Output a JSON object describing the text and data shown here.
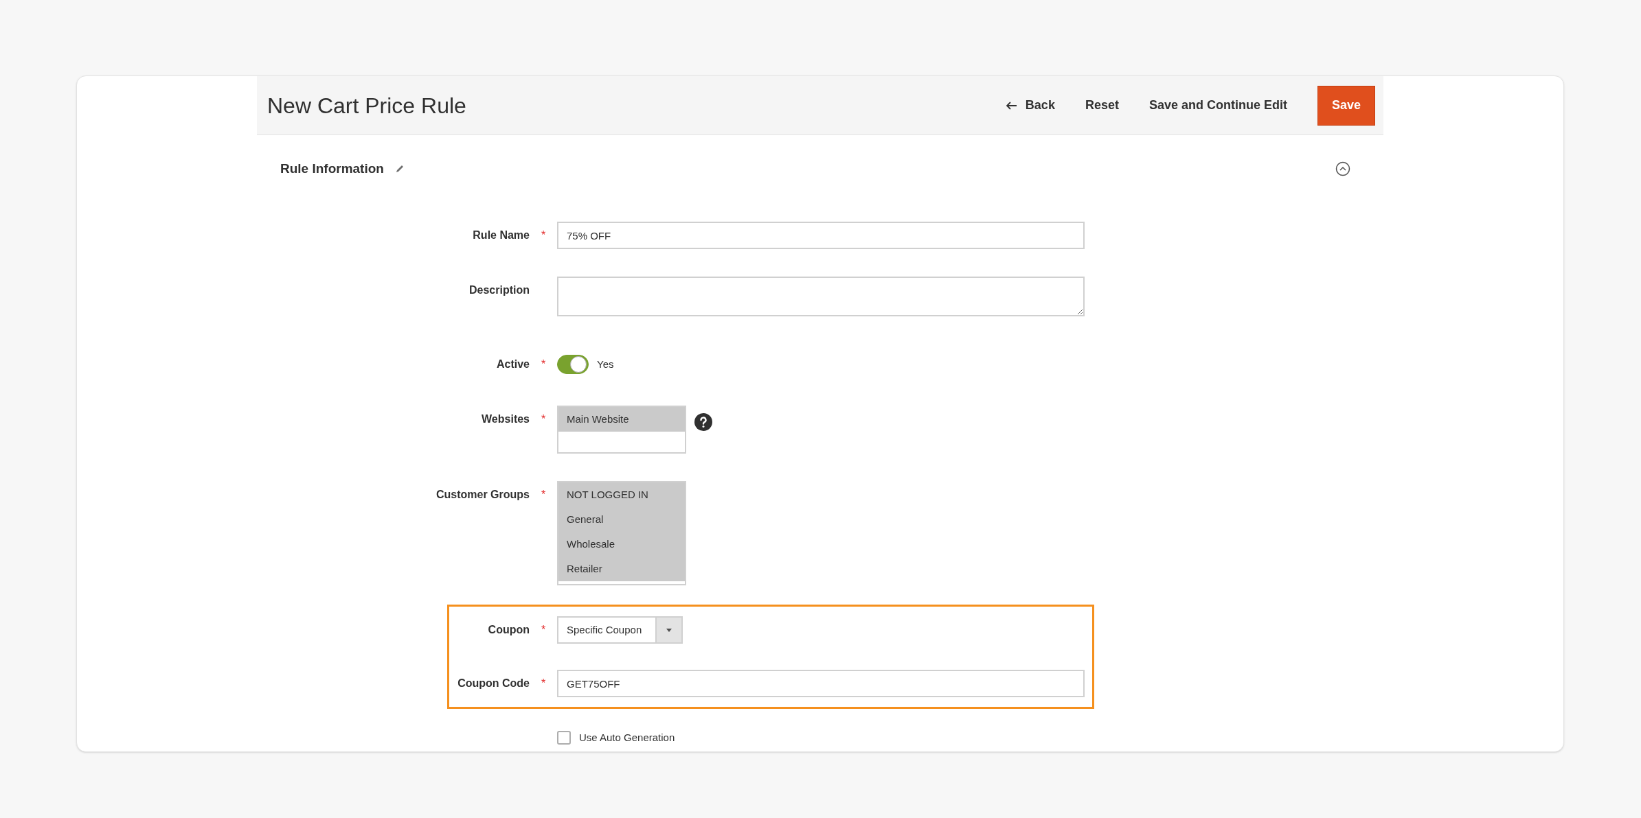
{
  "page_title": "New Cart Price Rule",
  "actions": [
    {
      "kind": "back",
      "label": "Back"
    },
    {
      "kind": "link",
      "label": "Reset"
    },
    {
      "kind": "link",
      "label": "Save and Continue Edit"
    },
    {
      "kind": "primary",
      "label": "Save"
    }
  ],
  "section": {
    "title": "Rule Information",
    "expanded": true
  },
  "fields": [
    {
      "kind": "text",
      "label": "Rule Name",
      "required": "*",
      "value": "75% OFF"
    },
    {
      "kind": "textarea",
      "label": "Description"
    },
    {
      "kind": "toggle",
      "label": "Active",
      "required": "*",
      "on": true,
      "value_label": "Yes"
    },
    {
      "kind": "multiselect",
      "label": "Websites",
      "required": "*",
      "help": true,
      "options": [
        {
          "label": "Main Website",
          "selected": true
        }
      ]
    },
    {
      "kind": "multiselect",
      "label": "Customer Groups",
      "required": "*",
      "options": [
        {
          "label": "NOT LOGGED IN",
          "selected": true
        },
        {
          "label": "General",
          "selected": true
        },
        {
          "label": "Wholesale",
          "selected": true
        },
        {
          "label": "Retailer",
          "selected": true
        }
      ]
    },
    {
      "kind": "highlight",
      "fields": [
        {
          "kind": "select",
          "label": "Coupon",
          "required": "*",
          "value": "Specific Coupon"
        },
        {
          "kind": "text",
          "label": "Coupon Code",
          "required": "*",
          "value": "GET75OFF"
        }
      ]
    },
    {
      "kind": "checkbox",
      "label": "Use Auto Generation",
      "checked": false
    }
  ]
}
